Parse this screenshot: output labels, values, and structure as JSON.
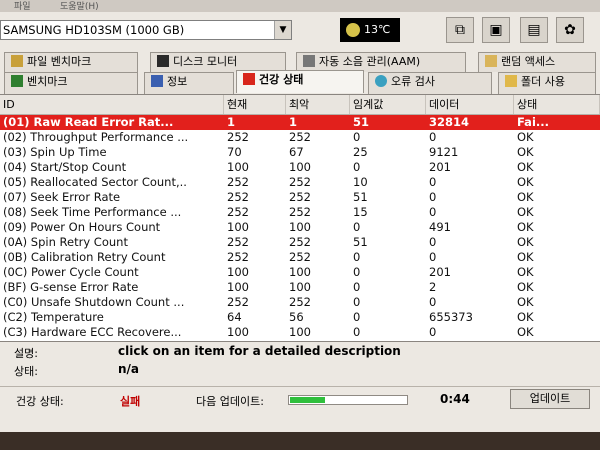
{
  "topbar": {
    "items": [
      "파일",
      "도움말(H)"
    ]
  },
  "drive": {
    "selected": "SAMSUNG HD103SM (1000 GB)",
    "temperature": "13℃"
  },
  "tabs_row1": [
    {
      "label": "파일 벤치마크",
      "icon": "benchmark-file-icon"
    },
    {
      "label": "디스크 모니터",
      "icon": "disk-monitor-icon"
    },
    {
      "label": "자동 소음 관리(AAM)",
      "icon": "speaker-icon"
    },
    {
      "label": "랜덤 액세스",
      "icon": "random-access-icon"
    }
  ],
  "tabs_row2": [
    {
      "label": "벤치마크",
      "icon": "benchmark-icon"
    },
    {
      "label": "정보",
      "icon": "info-icon"
    },
    {
      "label": "건강 상태",
      "icon": "health-cross-icon"
    },
    {
      "label": "오류 검사",
      "icon": "magnifier-icon"
    },
    {
      "label": "폴더 사용",
      "icon": "folder-icon"
    }
  ],
  "table": {
    "headers": [
      "ID",
      "현재",
      "최악",
      "임계값",
      "데이터",
      "상태"
    ],
    "rows": [
      [
        "(01) Raw Read Error Rat...",
        "1",
        "1",
        "51",
        "32814",
        "Fai..."
      ],
      [
        "(02) Throughput Performance ...",
        "252",
        "252",
        "0",
        "0",
        "OK"
      ],
      [
        "(03) Spin Up Time",
        "70",
        "67",
        "25",
        "9121",
        "OK"
      ],
      [
        "(04) Start/Stop Count",
        "100",
        "100",
        "0",
        "201",
        "OK"
      ],
      [
        "(05) Reallocated Sector Count,..",
        "252",
        "252",
        "10",
        "0",
        "OK"
      ],
      [
        "(07) Seek Error Rate",
        "252",
        "252",
        "51",
        "0",
        "OK"
      ],
      [
        "(08) Seek Time Performance ...",
        "252",
        "252",
        "15",
        "0",
        "OK"
      ],
      [
        "(09) Power On Hours Count",
        "100",
        "100",
        "0",
        "491",
        "OK"
      ],
      [
        "(0A) Spin Retry Count",
        "252",
        "252",
        "51",
        "0",
        "OK"
      ],
      [
        "(0B) Calibration Retry Count",
        "252",
        "252",
        "0",
        "0",
        "OK"
      ],
      [
        "(0C) Power Cycle Count",
        "100",
        "100",
        "0",
        "201",
        "OK"
      ],
      [
        "(BF) G-sense Error Rate",
        "100",
        "100",
        "0",
        "2",
        "OK"
      ],
      [
        "(C0) Unsafe Shutdown Count ...",
        "252",
        "252",
        "0",
        "0",
        "OK"
      ],
      [
        "(C2) Temperature",
        "64",
        "56",
        "0",
        "655373",
        "OK"
      ],
      [
        "(C3) Hardware ECC Recovere...",
        "100",
        "100",
        "0",
        "0",
        "OK"
      ]
    ]
  },
  "description": {
    "label1": "설명:",
    "text": "click on an item for a detailed description",
    "label2": "상태:",
    "status": "n/a"
  },
  "statusbar": {
    "health_label": "건강 상태:",
    "health_value": "실패",
    "update_label": "다음 업데이트:",
    "progress_fraction": 0.3,
    "countdown": "0:44",
    "update_button": "업데이트"
  },
  "colors": {
    "fail_row": "#e2201c",
    "progress": "#2fbf3c"
  }
}
